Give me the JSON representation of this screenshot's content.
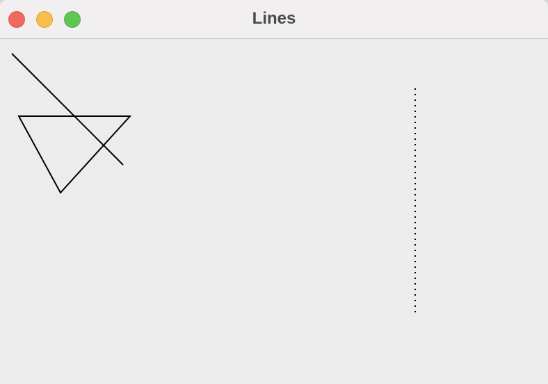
{
  "window": {
    "title": "Lines",
    "buttons": {
      "close": "close",
      "minimize": "minimize",
      "zoom": "zoom"
    }
  },
  "colors": {
    "titlebar": "#f1eff0",
    "canvas": "#ececec",
    "line": "#000000",
    "close": "#ee6a5f",
    "minimize": "#f5be4f",
    "zoom": "#61c554"
  }
}
